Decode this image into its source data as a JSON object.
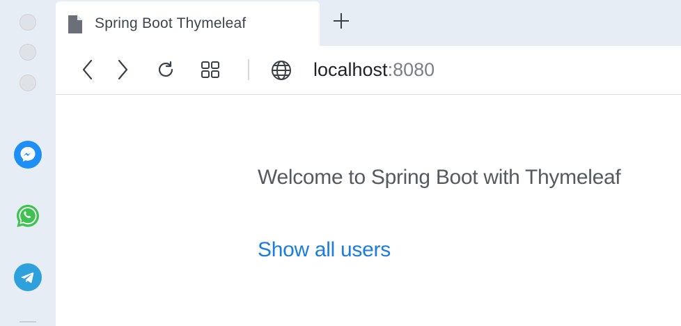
{
  "tab": {
    "title": "Spring Boot Thymeleaf",
    "icon": "document-icon"
  },
  "toolbar": {
    "address_host": "localhost",
    "address_port": ":8080",
    "icons": [
      "back-icon",
      "forward-icon",
      "reload-icon",
      "tabs-grid-icon",
      "globe-icon"
    ]
  },
  "sidebar": {
    "apps": [
      {
        "name": "messenger",
        "color": "#1e8ff5"
      },
      {
        "name": "whatsapp",
        "color": "#3fc251"
      },
      {
        "name": "telegram",
        "color": "#2ea1dc"
      }
    ]
  },
  "page": {
    "welcome": "Welcome to Spring Boot with Thymeleaf",
    "link": "Show all users"
  },
  "colors": {
    "link": "#1a7de0",
    "chrome_bg": "#e6edf5"
  }
}
